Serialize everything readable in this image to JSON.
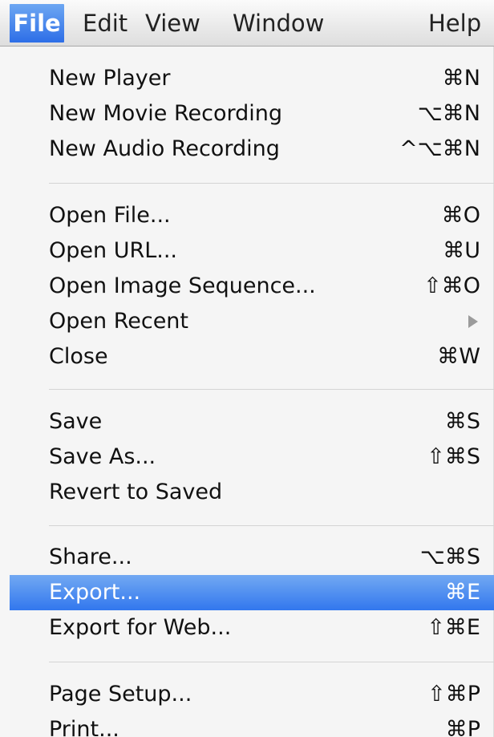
{
  "menubar": {
    "items": [
      {
        "label": "File",
        "active": true
      },
      {
        "label": "Edit",
        "active": false
      },
      {
        "label": "View",
        "active": false
      },
      {
        "label": "Window",
        "active": false
      },
      {
        "label": "Help",
        "active": false
      }
    ]
  },
  "file_menu": {
    "items": [
      {
        "label": "New Player",
        "shortcut": "⌘N"
      },
      {
        "label": "New Movie Recording",
        "shortcut": "⌥⌘N"
      },
      {
        "label": "New Audio Recording",
        "shortcut": "^⌥⌘N"
      },
      {
        "label": "Open File...",
        "shortcut": "⌘O"
      },
      {
        "label": "Open URL...",
        "shortcut": "⌘U"
      },
      {
        "label": "Open Image Sequence...",
        "shortcut": "⇧⌘O"
      },
      {
        "label": "Open Recent",
        "shortcut": "",
        "icon": "submenu-arrow-icon"
      },
      {
        "label": "Close",
        "shortcut": "⌘W"
      },
      {
        "label": "Save",
        "shortcut": "⌘S"
      },
      {
        "label": "Save As...",
        "shortcut": "⇧⌘S"
      },
      {
        "label": "Revert to Saved",
        "shortcut": ""
      },
      {
        "label": "Share...",
        "shortcut": "⌥⌘S"
      },
      {
        "label": "Export...",
        "shortcut": "⌘E",
        "highlighted": true
      },
      {
        "label": "Export for Web...",
        "shortcut": "⇧⌘E"
      },
      {
        "label": "Page Setup...",
        "shortcut": "⇧⌘P"
      },
      {
        "label": "Print...",
        "shortcut": "⌘P"
      }
    ]
  },
  "colors": {
    "selection": "#3277ee",
    "menu_background": "#f5f5f5",
    "text": "#111111",
    "separator": "#d4d4d4"
  }
}
